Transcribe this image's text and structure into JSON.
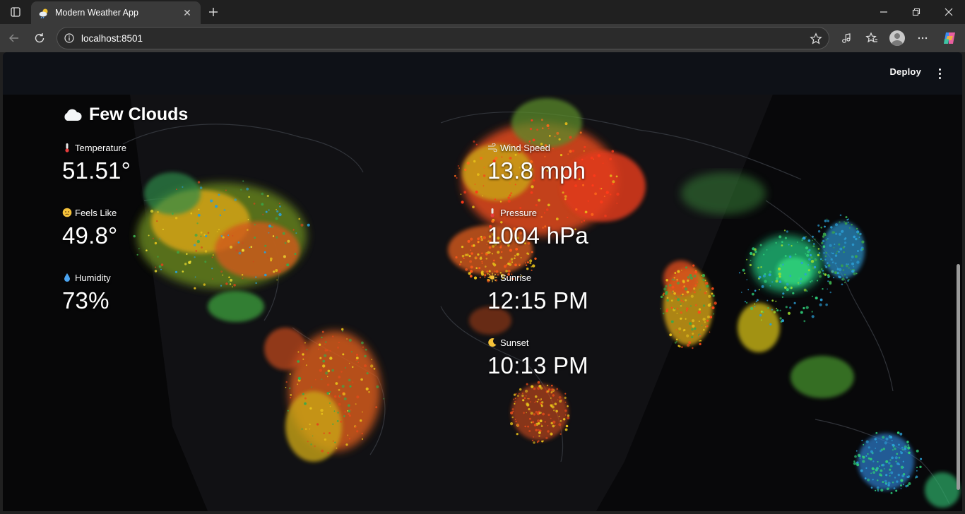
{
  "browser": {
    "tab_title": "Modern Weather App",
    "url": "localhost:8501"
  },
  "app_header": {
    "deploy_label": "Deploy"
  },
  "weather": {
    "condition": "Few Clouds",
    "left_metrics": [
      {
        "label": "Temperature",
        "value": "51.51°",
        "icon": "thermometer-icon"
      },
      {
        "label": "Feels Like",
        "value": "49.8°",
        "icon": "face-icon"
      },
      {
        "label": "Humidity",
        "value": "73%",
        "icon": "droplet-icon"
      }
    ],
    "right_metrics": [
      {
        "label": "Wind Speed",
        "value": "13.8 mph",
        "icon": "wind-icon"
      },
      {
        "label": "Pressure",
        "value": "1004 hPa",
        "icon": "thermometer-icon"
      },
      {
        "label": "Sunrise",
        "value": "12:15 PM",
        "icon": "sun-icon"
      },
      {
        "label": "Sunset",
        "value": "10:13 PM",
        "icon": "moon-icon"
      }
    ]
  },
  "colors": {
    "app_background": "#0e1117",
    "browser_frame": "#202020",
    "text": "#ffffff"
  }
}
